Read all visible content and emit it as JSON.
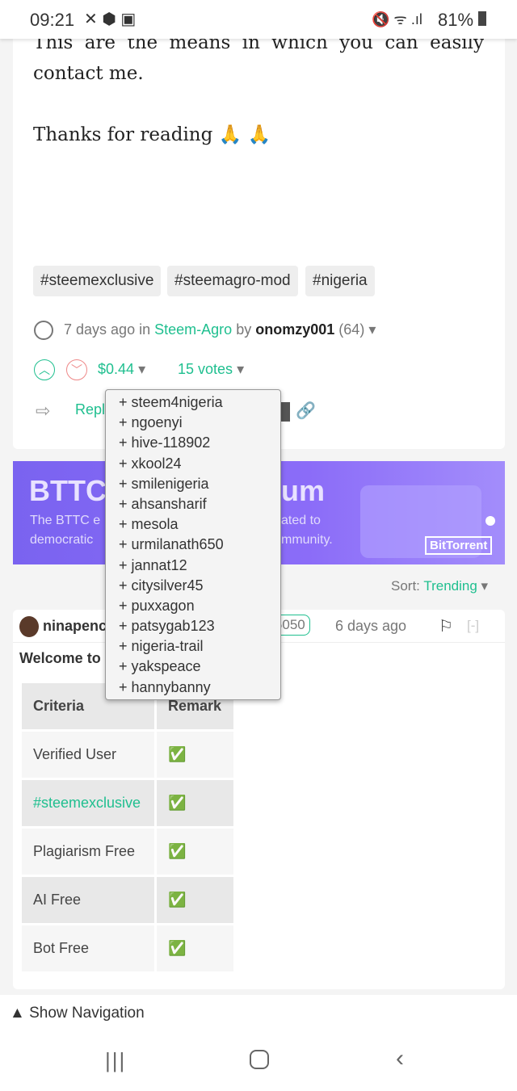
{
  "status_bar": {
    "time": "09:21",
    "battery": "81%"
  },
  "post": {
    "body_line1": "This are the means in which you can easily",
    "body_line2": "contact me.",
    "thanks": "Thanks for reading 🙏 🙏",
    "tags": [
      "#steemexclusive",
      "#steemagro-mod",
      "#nigeria"
    ],
    "time_ago": "7 days ago",
    "in_label": "in",
    "community": "Steem-Agro",
    "by_label": "by",
    "author": "onomzy001",
    "reputation": "(64)",
    "payout": "$0.44",
    "votes": "15 votes",
    "reply_label": "Repl"
  },
  "voters": [
    "+ steem4nigeria",
    "+ ngoenyi",
    "+ hive-118902",
    "+ xkool24",
    "+ smilenigeria",
    "+ ahsansharif",
    "+ mesola",
    "+ urmilanath650",
    "+ jannat12",
    "+ citysilver45",
    "+ puxxagon",
    "+ patsygab123",
    "+ nigeria-trail",
    "+ yakspeace",
    "+ hannybanny"
  ],
  "banner": {
    "title_left": "BTTC",
    "title_right": "um",
    "line1_left": "The BTTC e",
    "line1_right": "ated to",
    "line2_left": "democratic",
    "line2_right": "mmunity.",
    "brand": "BitTorrent"
  },
  "sort": {
    "label": "Sort:",
    "value": "Trending"
  },
  "comment": {
    "author": "ninapenc",
    "badge": "ub5050",
    "time": "6 days ago",
    "collapse": "[-]",
    "intro": "Welcome to s",
    "table": {
      "headers": [
        "Criteria",
        "Remark"
      ],
      "rows": [
        [
          "Verified User",
          "✅"
        ],
        [
          "#steemexclusive",
          "✅"
        ],
        [
          "Plagiarism Free",
          "✅"
        ],
        [
          "AI Free",
          "✅"
        ],
        [
          "Bot Free",
          "✅"
        ]
      ]
    }
  },
  "bottom": {
    "show_nav": "Show Navigation"
  }
}
